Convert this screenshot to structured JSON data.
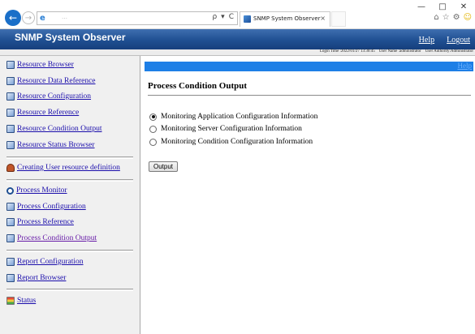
{
  "browser": {
    "url": "…",
    "tab_title": "SNMP System Observer",
    "tab_close": "×",
    "search_glyph": "ρ",
    "dropdown_glyph": "▾",
    "refresh_glyph": "C",
    "minimize": "—",
    "maximize": "□",
    "close": "✕",
    "home_glyph": "⌂",
    "star_glyph": "☆",
    "gear_glyph": "⚙",
    "smile_glyph": "☺"
  },
  "app": {
    "title": "SNMP System Observer",
    "help_link": "Help",
    "logout_link": "Logout",
    "login_time": "Login Time :2022/01/27 13:30:45",
    "user_name": "User Name :administrator",
    "user_authority": "User Authority:Administrator"
  },
  "sidebar": {
    "items": [
      {
        "label": "Resource Browser",
        "icon": "resource-browser-icon"
      },
      {
        "label": "Resource Data Reference",
        "icon": "resource-data-reference-icon"
      },
      {
        "label": "Resource Configuration",
        "icon": "resource-configuration-icon"
      },
      {
        "label": "Resource Reference",
        "icon": "resource-reference-icon"
      },
      {
        "label": "Resource Condition Output",
        "icon": "resource-condition-output-icon"
      },
      {
        "label": "Resource Status Browser",
        "icon": "resource-status-browser-icon"
      },
      {
        "label": "Creating User resource definition",
        "icon": "user-resource-icon"
      },
      {
        "label": "Process Monitor",
        "icon": "process-monitor-icon"
      },
      {
        "label": "Process Configuration",
        "icon": "process-configuration-icon"
      },
      {
        "label": "Process Reference",
        "icon": "process-reference-icon"
      },
      {
        "label": "Process Condition Output",
        "icon": "process-condition-output-icon"
      },
      {
        "label": "Report Configuration",
        "icon": "report-configuration-icon"
      },
      {
        "label": "Report Browser",
        "icon": "report-browser-icon"
      },
      {
        "label": "Status",
        "icon": "status-icon"
      }
    ]
  },
  "main": {
    "help_link": "Help",
    "title": "Process Condition Output",
    "options": [
      {
        "label": "Monitoring Application Configuration Information",
        "selected": true
      },
      {
        "label": "Monitoring Server Configuration Information",
        "selected": false
      },
      {
        "label": "Monitoring Condition Configuration Information",
        "selected": false
      }
    ],
    "output_button": "Output"
  },
  "colors": {
    "header_blue": "#1f4f92",
    "help_bar_blue": "#1e7fe6",
    "link": "#1a0dab",
    "visited_link": "#681da8"
  }
}
